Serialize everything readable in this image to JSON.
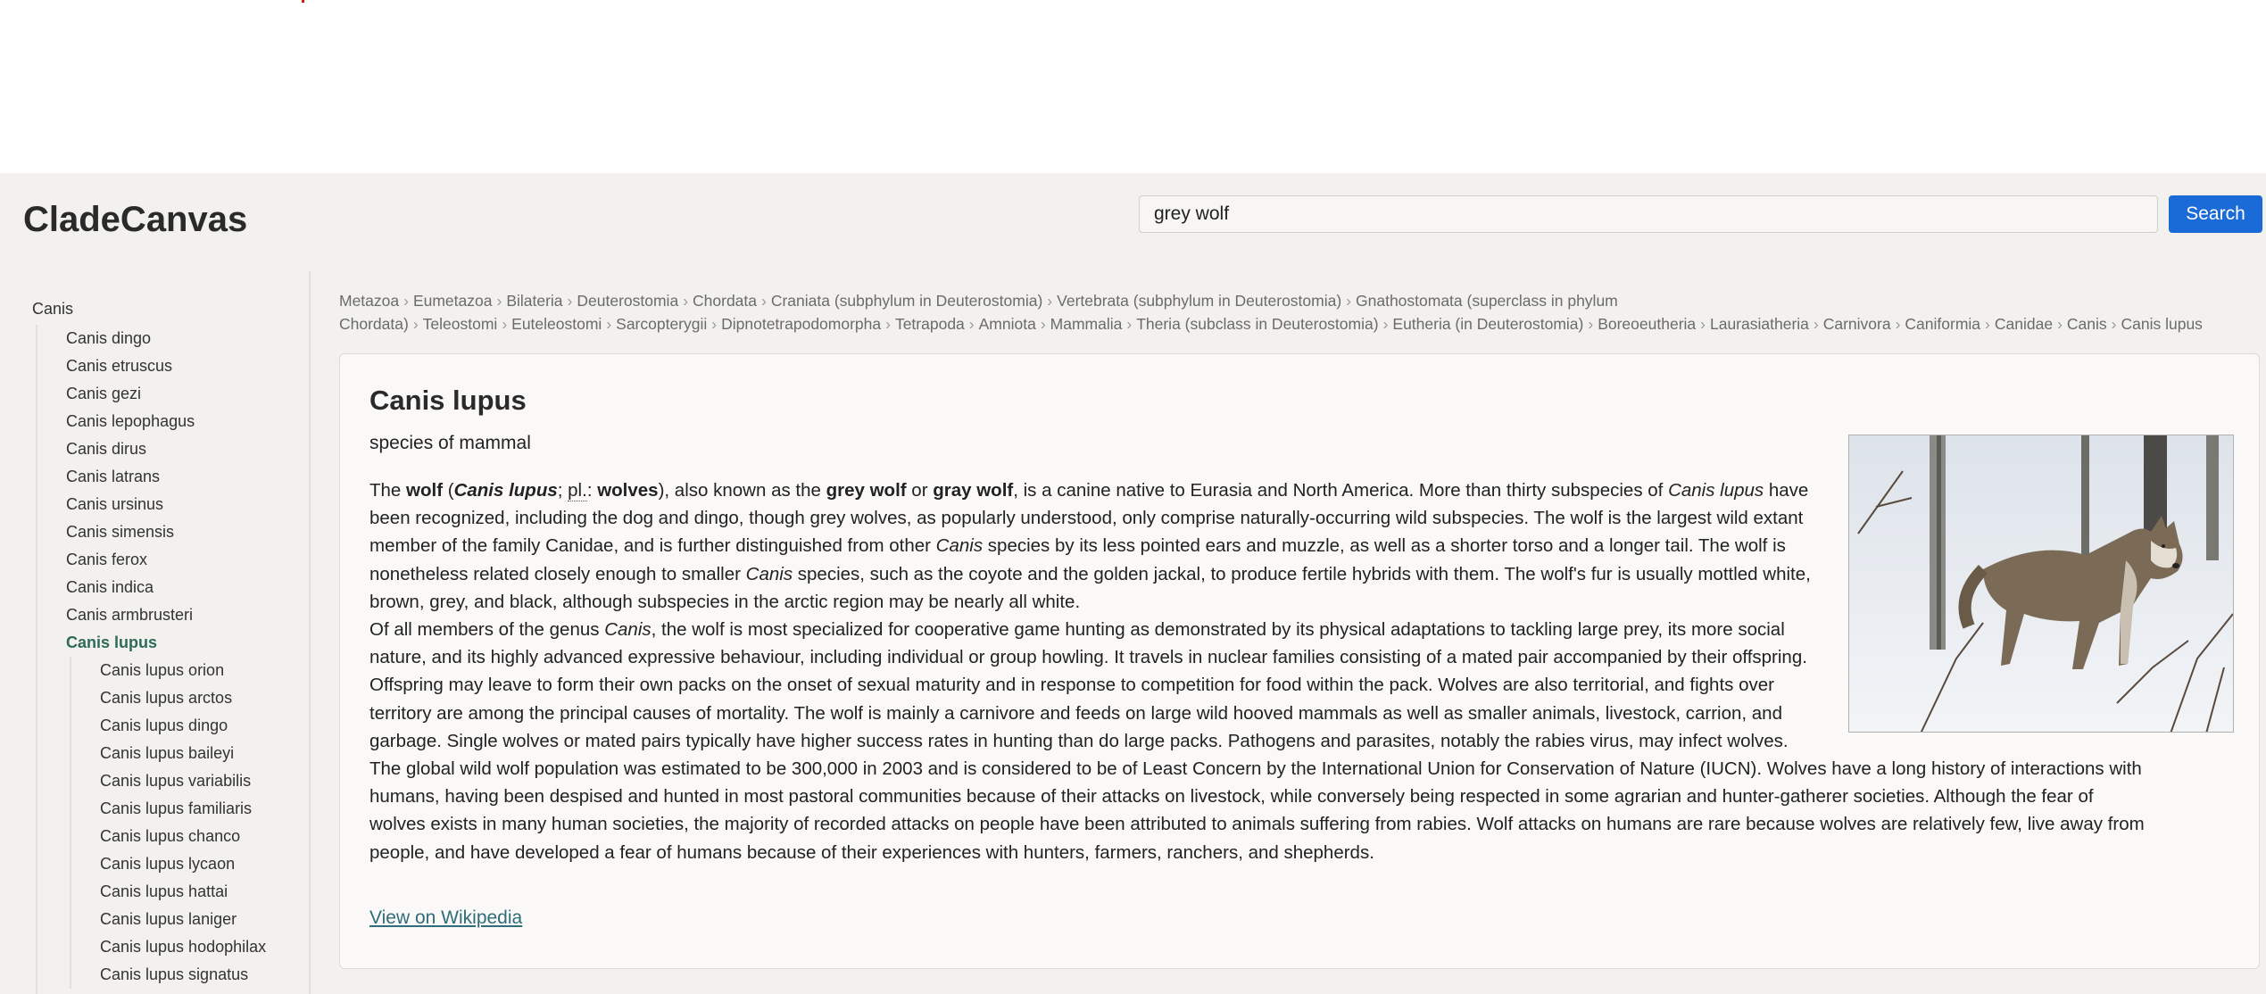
{
  "app": {
    "brand": "CladeCanvas"
  },
  "search": {
    "value": "grey wolf",
    "button_label": "Search"
  },
  "sidebar": {
    "root": "Canis",
    "siblings": [
      "Canis dingo",
      "Canis etruscus",
      "Canis gezi",
      "Canis lepophagus",
      "Canis dirus",
      "Canis latrans",
      "Canis ursinus",
      "Canis simensis",
      "Canis ferox",
      "Canis indica",
      "Canis armbrusteri"
    ],
    "active": "Canis lupus",
    "children": [
      "Canis lupus orion",
      "Canis lupus arctos",
      "Canis lupus dingo",
      "Canis lupus baileyi",
      "Canis lupus variabilis",
      "Canis lupus familiaris",
      "Canis lupus chanco",
      "Canis lupus lycaon",
      "Canis lupus hattai",
      "Canis lupus laniger",
      "Canis lupus hodophilax",
      "Canis lupus signatus"
    ]
  },
  "breadcrumb": [
    "Metazoa",
    "Eumetazoa",
    "Bilateria",
    "Deuterostomia",
    "Chordata",
    "Craniata (subphylum in Deuterostomia)",
    "Vertebrata (subphylum in Deuterostomia)",
    "Gnathostomata (superclass in phylum Chordata)",
    "Teleostomi",
    "Euteleostomi",
    "Sarcopterygii",
    "Dipnotetrapodomorpha",
    "Tetrapoda",
    "Amniota",
    "Mammalia",
    "Theria (subclass in Deuterostomia)",
    "Eutheria (in Deuterostomia)",
    "Boreoeutheria",
    "Laurasiatheria",
    "Carnivora",
    "Caniformia",
    "Canidae",
    "Canis",
    "Canis lupus"
  ],
  "taxon": {
    "title": "Canis lupus",
    "subtitle": "species of mammal",
    "p1": {
      "t1": "The ",
      "b1": "wolf",
      "t2": " (",
      "bi1": "Canis lupus",
      "t3": "; ",
      "abbr": "pl.",
      "t4": ": ",
      "b2": "wolves",
      "t5": "), also known as the ",
      "b3": "grey wolf",
      "t6": " or ",
      "b4": "gray wolf",
      "t7": ", is a canine native to Eurasia and North America. More than thirty subspecies of ",
      "i1": "Canis lupus",
      "t8": " have been recognized, including the dog and dingo, though grey wolves, as popularly understood, only comprise naturally-occurring wild subspecies. The wolf is the largest wild extant member of the family Canidae, and is further distinguished from other ",
      "i2": "Canis",
      "t9": " species by its less pointed ears and muzzle, as well as a shorter torso and a longer tail. The wolf is nonetheless related closely enough to smaller ",
      "i3": "Canis",
      "t10": " species, such as the coyote and the golden jackal, to produce fertile hybrids with them. The wolf's fur is usually mottled white, brown, grey, and black, although subspecies in the arctic region may be nearly all white."
    },
    "p2": {
      "t1": "Of all members of the genus ",
      "i1": "Canis",
      "t2": ", the wolf is most specialized for cooperative game hunting as demonstrated by its physical adaptations to tackling large prey, its more social nature, and its highly advanced expressive behaviour, including individual or group howling. It travels in nuclear families consisting of a mated pair accompanied by their offspring. Offspring may leave to form their own packs on the onset of sexual maturity and in response to competition for food within the pack. Wolves are also territorial, and fights over territory are among the principal causes of mortality. The wolf is mainly a carnivore and feeds on large wild hooved mammals as well as smaller animals, livestock, carrion, and garbage. Single wolves or mated pairs typically have higher success rates in hunting than do large packs. Pathogens and parasites, notably the rabies virus, may infect wolves."
    },
    "p3": "The global wild wolf population was estimated to be 300,000 in 2003 and is considered to be of Least Concern by the International Union for Conservation of Nature (IUCN). Wolves have a long history of interactions with humans, having been despised and hunted in most pastoral communities because of their attacks on livestock, while conversely being respected in some agrarian and hunter-gatherer societies. Although the fear of wolves exists in many human societies, the majority of recorded attacks on people have been attributed to animals suffering from rabies. Wolf attacks on humans are rare because wolves are relatively few, live away from people, and have developed a fear of humans because of their experiences with hunters, farmers, ranchers, and shepherds.",
    "link_label": "View on Wikipedia"
  },
  "colors": {
    "accent": "#1a6bd8",
    "active_tree": "#2e6a5a",
    "link": "#2f6d7a",
    "app_bg": "#f2f1ee",
    "card_bg": "#faf9f7"
  }
}
